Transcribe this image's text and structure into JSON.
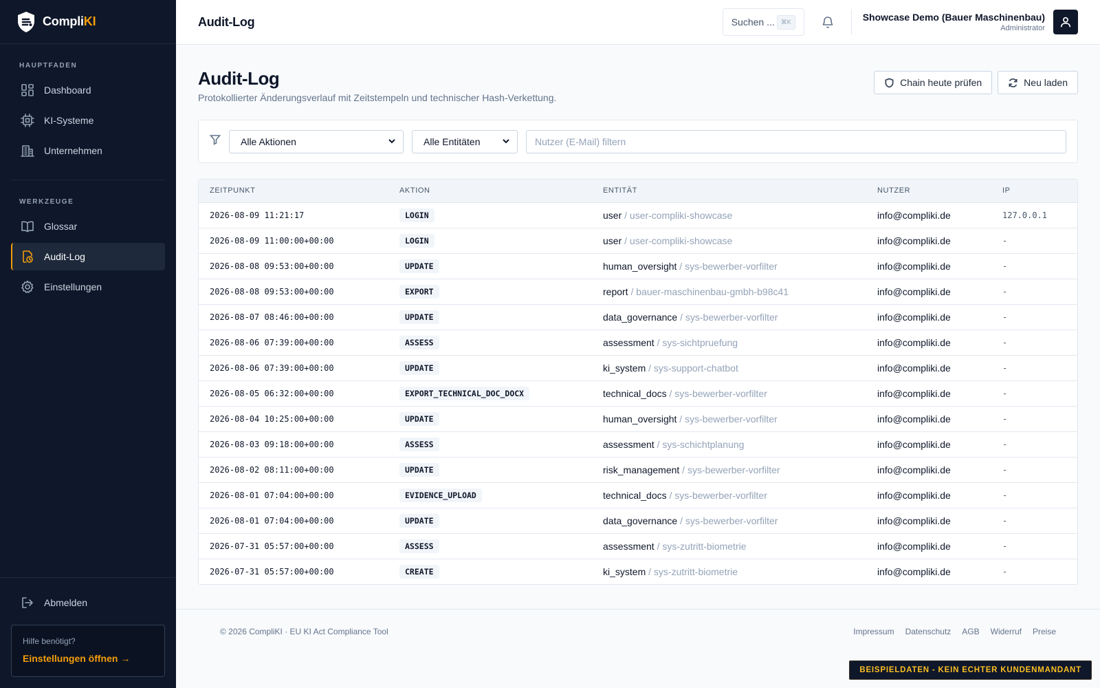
{
  "brand": {
    "name_main": "Compli",
    "name_accent": "KI"
  },
  "sidebar": {
    "section_main": "HAUPTFADEN",
    "section_tools": "WERKZEUGE",
    "items_main": [
      {
        "label": "Dashboard",
        "icon": "dashboard-icon"
      },
      {
        "label": "KI-Systeme",
        "icon": "cpu-icon"
      },
      {
        "label": "Unternehmen",
        "icon": "building-icon"
      }
    ],
    "items_tools": [
      {
        "label": "Glossar",
        "icon": "book-icon"
      },
      {
        "label": "Audit-Log",
        "icon": "audit-icon",
        "active": true
      },
      {
        "label": "Einstellungen",
        "icon": "gear-icon"
      }
    ],
    "logout": "Abmelden",
    "help_title": "Hilfe benötigt?",
    "help_link": "Einstellungen öffnen →"
  },
  "header": {
    "title": "Audit-Log",
    "search_label": "Suchen ...",
    "search_kbd": "⌘K",
    "user_name": "Showcase Demo (Bauer Maschinenbau)",
    "user_role": "Administrator"
  },
  "page": {
    "title": "Audit-Log",
    "subtitle": "Protokollierter Änderungsverlauf mit Zeitstempeln und technischer Hash-Verkettung.",
    "btn_chain": "Chain heute prüfen",
    "btn_reload": "Neu laden"
  },
  "filters": {
    "actions_value": "Alle Aktionen",
    "entities_value": "Alle Entitäten",
    "user_placeholder": "Nutzer (E-Mail) filtern"
  },
  "table": {
    "columns": [
      "ZEITPUNKT",
      "AKTION",
      "ENTITÄT",
      "NUTZER",
      "IP"
    ],
    "rows": [
      {
        "ts": "2026-08-09 11:21:17",
        "action": "LOGIN",
        "entity": "user",
        "entity_id": "/ user-compliki-showcase",
        "user": "info@compliki.de",
        "ip": "127.0.0.1"
      },
      {
        "ts": "2026-08-09 11:00:00+00:00",
        "action": "LOGIN",
        "entity": "user",
        "entity_id": "/ user-compliki-showcase",
        "user": "info@compliki.de",
        "ip": "-"
      },
      {
        "ts": "2026-08-08 09:53:00+00:00",
        "action": "UPDATE",
        "entity": "human_oversight",
        "entity_id": "/ sys-bewerber-vorfilter",
        "user": "info@compliki.de",
        "ip": "-"
      },
      {
        "ts": "2026-08-08 09:53:00+00:00",
        "action": "EXPORT",
        "entity": "report",
        "entity_id": "/ bauer-maschinenbau-gmbh-b98c41",
        "user": "info@compliki.de",
        "ip": "-"
      },
      {
        "ts": "2026-08-07 08:46:00+00:00",
        "action": "UPDATE",
        "entity": "data_governance",
        "entity_id": "/ sys-bewerber-vorfilter",
        "user": "info@compliki.de",
        "ip": "-"
      },
      {
        "ts": "2026-08-06 07:39:00+00:00",
        "action": "ASSESS",
        "entity": "assessment",
        "entity_id": "/ sys-sichtpruefung",
        "user": "info@compliki.de",
        "ip": "-"
      },
      {
        "ts": "2026-08-06 07:39:00+00:00",
        "action": "UPDATE",
        "entity": "ki_system",
        "entity_id": "/ sys-support-chatbot",
        "user": "info@compliki.de",
        "ip": "-"
      },
      {
        "ts": "2026-08-05 06:32:00+00:00",
        "action": "EXPORT_TECHNICAL_DOC_DOCX",
        "entity": "technical_docs",
        "entity_id": "/ sys-bewerber-vorfilter",
        "user": "info@compliki.de",
        "ip": "-"
      },
      {
        "ts": "2026-08-04 10:25:00+00:00",
        "action": "UPDATE",
        "entity": "human_oversight",
        "entity_id": "/ sys-bewerber-vorfilter",
        "user": "info@compliki.de",
        "ip": "-"
      },
      {
        "ts": "2026-08-03 09:18:00+00:00",
        "action": "ASSESS",
        "entity": "assessment",
        "entity_id": "/ sys-schichtplanung",
        "user": "info@compliki.de",
        "ip": "-"
      },
      {
        "ts": "2026-08-02 08:11:00+00:00",
        "action": "UPDATE",
        "entity": "risk_management",
        "entity_id": "/ sys-bewerber-vorfilter",
        "user": "info@compliki.de",
        "ip": "-"
      },
      {
        "ts": "2026-08-01 07:04:00+00:00",
        "action": "EVIDENCE_UPLOAD",
        "entity": "technical_docs",
        "entity_id": "/ sys-bewerber-vorfilter",
        "user": "info@compliki.de",
        "ip": "-"
      },
      {
        "ts": "2026-08-01 07:04:00+00:00",
        "action": "UPDATE",
        "entity": "data_governance",
        "entity_id": "/ sys-bewerber-vorfilter",
        "user": "info@compliki.de",
        "ip": "-"
      },
      {
        "ts": "2026-07-31 05:57:00+00:00",
        "action": "ASSESS",
        "entity": "assessment",
        "entity_id": "/ sys-zutritt-biometrie",
        "user": "info@compliki.de",
        "ip": "-"
      },
      {
        "ts": "2026-07-31 05:57:00+00:00",
        "action": "CREATE",
        "entity": "ki_system",
        "entity_id": "/ sys-zutritt-biometrie",
        "user": "info@compliki.de",
        "ip": "-"
      }
    ]
  },
  "footer": {
    "copyright": "© 2026 CompliKI · EU KI Act Compliance Tool",
    "links": [
      "Impressum",
      "Datenschutz",
      "AGB",
      "Widerruf",
      "Preise"
    ]
  },
  "banner": "BEISPIELDATEN - KEIN ECHTER KUNDENMANDANT",
  "colors": {
    "sidebar_bg": "#0f172a",
    "accent": "#f59e0b",
    "page_bg": "#f8fafc"
  }
}
